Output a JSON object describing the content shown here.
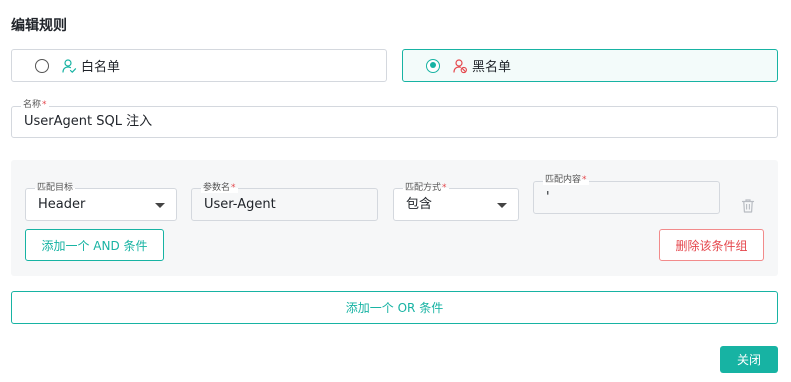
{
  "dialog": {
    "title": "编辑规则"
  },
  "list_type": {
    "options": [
      {
        "label": "白名单",
        "icon": "user-check-icon",
        "selected": false
      },
      {
        "label": "黑名单",
        "icon": "user-block-icon",
        "selected": true
      }
    ]
  },
  "name_field": {
    "label": "名称",
    "required_mark": "*",
    "value": "UserAgent SQL 注入"
  },
  "condition_group": {
    "conditions": [
      {
        "match_target": {
          "label": "匹配目标",
          "value": "Header"
        },
        "param_name": {
          "label": "参数名",
          "required_mark": "*",
          "value": "User-Agent"
        },
        "match_method": {
          "label": "匹配方式",
          "required_mark": "*",
          "value": "包含"
        },
        "match_content": {
          "label": "匹配内容",
          "required_mark": "*",
          "value": "'"
        }
      }
    ],
    "add_and_label": "添加一个 AND 条件",
    "delete_group_label": "删除该条件组"
  },
  "add_or_label": "添加一个 OR 条件",
  "close_label": "关闭",
  "colors": {
    "accent": "#17b3a3",
    "danger": "#e5484d",
    "panel_bg": "#f6f7f8",
    "border": "#d4d8de"
  }
}
